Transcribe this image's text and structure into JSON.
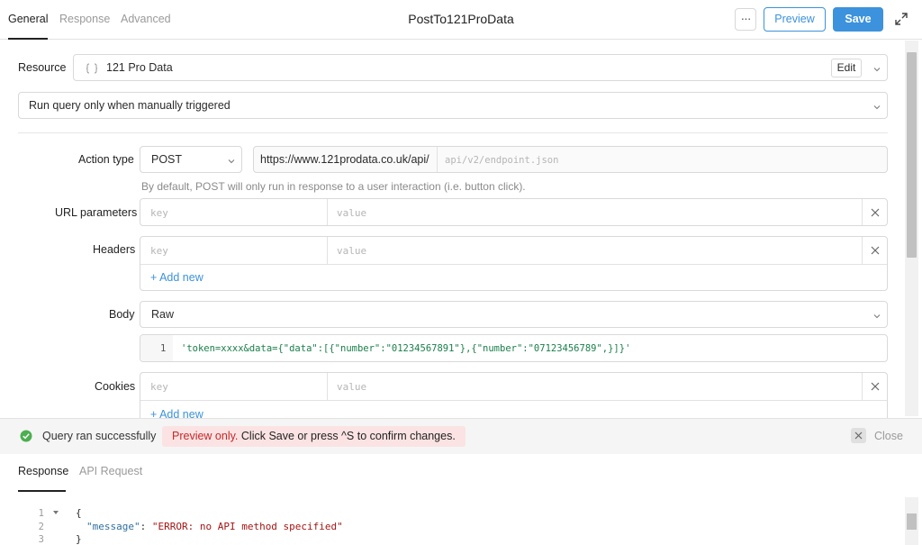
{
  "tabs": [
    {
      "label": "General"
    },
    {
      "label": "Response"
    },
    {
      "label": "Advanced"
    }
  ],
  "query_name": "PostTo121ProData",
  "toolbar": {
    "more_label": "···",
    "preview_label": "Preview",
    "save_label": "Save"
  },
  "resource": {
    "label": "Resource",
    "value": "121 Pro Data",
    "edit_label": "Edit"
  },
  "trigger": {
    "value": "Run query only when manually triggered"
  },
  "action": {
    "label": "Action type",
    "method": "POST",
    "base_url": "https://www.121prodata.co.uk/api/",
    "path_placeholder": "api/v2/endpoint.json",
    "hint": "By default, POST will only run in response to a user interaction (i.e. button click)."
  },
  "url_params": {
    "label": "URL parameters",
    "key_placeholder": "key",
    "value_placeholder": "value"
  },
  "headers": {
    "label": "Headers",
    "key_placeholder": "key",
    "value_placeholder": "value",
    "add_label": "+ Add new"
  },
  "body": {
    "label": "Body",
    "type": "Raw",
    "line_number": "1",
    "content": "'token=xxxx&data={\"data\":[{\"number\":\"01234567891\"},{\"number\":\"07123456789\",}]}'"
  },
  "cookies": {
    "label": "Cookies",
    "key_placeholder": "key",
    "value_placeholder": "value",
    "add_label": "+ Add new"
  },
  "status": {
    "message": "Query ran successfully",
    "preview_prefix": "Preview only.",
    "preview_mid1": " Click ",
    "preview_save": "Save",
    "preview_mid2": " or press ^S to confirm changes.",
    "close_label": "Close"
  },
  "response_tabs": [
    {
      "label": "Response"
    },
    {
      "label": "API Request"
    }
  ],
  "response_code": {
    "lines": [
      "1",
      "2",
      "3"
    ],
    "open_brace": "{",
    "key": "\"message\"",
    "colon": ": ",
    "value": "\"ERROR: no API method specified\"",
    "close_brace": "}"
  },
  "colors": {
    "accent": "#3c92dc",
    "success": "#4caf50",
    "error": "#c62828"
  }
}
